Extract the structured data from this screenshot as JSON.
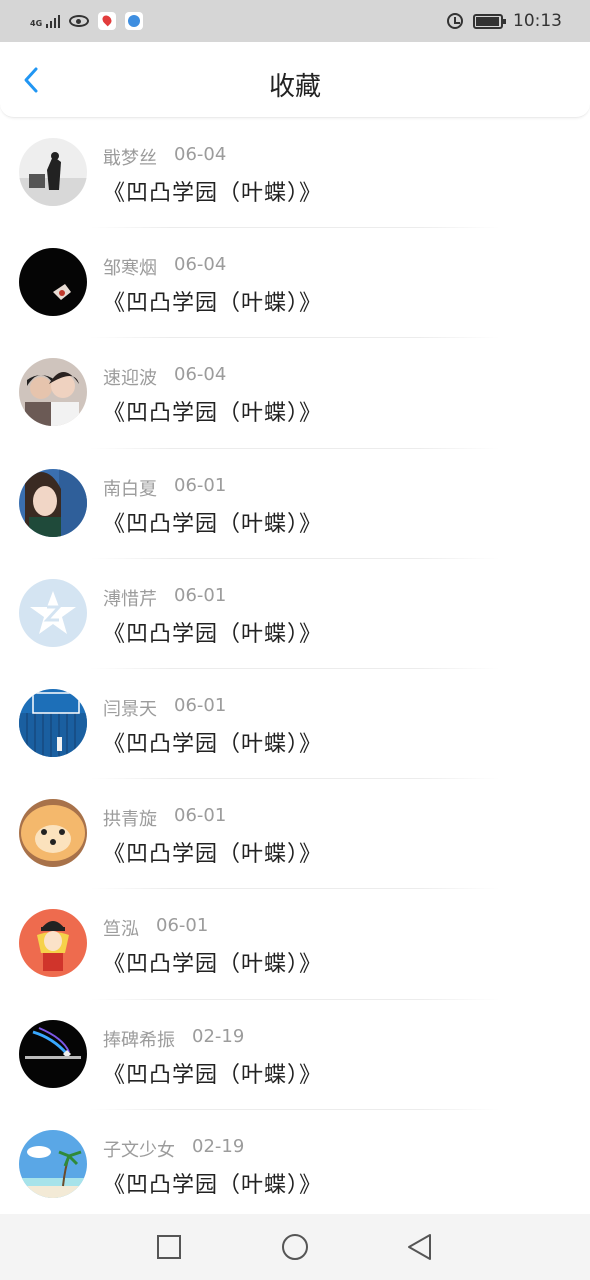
{
  "status_bar": {
    "network": "4G",
    "time": "10:13",
    "battery_percent": 95
  },
  "header": {
    "title": "收藏",
    "back_icon": "chevron-left-icon"
  },
  "items": [
    {
      "name": "戢梦丝",
      "date": "06-04",
      "title": "《凹凸学园（叶蝶）》"
    },
    {
      "name": "邹寒烟",
      "date": "06-04",
      "title": "《凹凸学园（叶蝶）》"
    },
    {
      "name": "速迎波",
      "date": "06-04",
      "title": "《凹凸学园（叶蝶）》"
    },
    {
      "name": "南白夏",
      "date": "06-01",
      "title": "《凹凸学园（叶蝶）》"
    },
    {
      "name": "溥惜芹",
      "date": "06-01",
      "title": "《凹凸学园（叶蝶）》"
    },
    {
      "name": "闫景天",
      "date": "06-01",
      "title": "《凹凸学园（叶蝶）》"
    },
    {
      "name": "拱青旋",
      "date": "06-01",
      "title": "《凹凸学园（叶蝶）》"
    },
    {
      "name": "笪泓",
      "date": "06-01",
      "title": "《凹凸学园（叶蝶）》"
    },
    {
      "name": "捧碑希振",
      "date": "02-19",
      "title": "《凹凸学园（叶蝶）》"
    },
    {
      "name": "子文少女",
      "date": "02-19",
      "title": "《凹凸学园（叶蝶）》"
    }
  ],
  "nav_bar": {
    "recent_icon": "square-icon",
    "home_icon": "circle-icon",
    "back_icon": "triangle-back-icon"
  },
  "colors": {
    "accent": "#2196f3",
    "meta_text": "#9c9c9c",
    "title_text": "#222222"
  }
}
